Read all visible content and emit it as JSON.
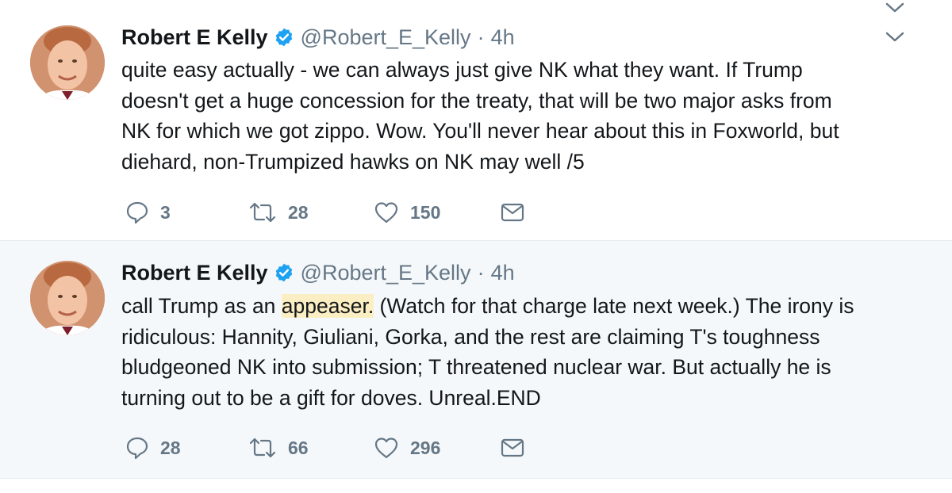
{
  "tweets": [
    {
      "author": {
        "name": "Robert E Kelly",
        "handle": "@Robert_E_Kelly",
        "verified": true,
        "avatar_icon": "avatar-photo"
      },
      "separator": "·",
      "time": "4h",
      "text_lines": [
        "quite easy actually - we can always just give NK what they want. If Trump",
        "doesn't get a huge concession for the treaty, that will be two major asks from",
        "NK for which we got zippo. Wow. You'll never hear about this in Foxworld, but",
        "diehard, non-Trumpized hawks on NK may well  /5"
      ],
      "actions": {
        "replies": "3",
        "retweets": "28",
        "likes": "150"
      }
    },
    {
      "author": {
        "name": "Robert E Kelly",
        "handle": "@Robert_E_Kelly",
        "verified": true,
        "avatar_icon": "avatar-photo"
      },
      "separator": "·",
      "time": "4h",
      "text_line1_before": "call Trump as an ",
      "text_highlight": "appeaser.",
      "text_line1_after": " (Watch for that charge late next week.) The irony is",
      "text_lines": [
        "ridiculous: Hannity, Giuliani, Gorka, and the rest are claiming T's toughness",
        "bludgeoned NK into submission; T threatened nuclear war. But actually he is",
        "turning out to be a gift for doves. Unreal.END"
      ],
      "actions": {
        "replies": "28",
        "retweets": "66",
        "likes": "296"
      }
    }
  ],
  "icons": [
    "verified-badge-icon",
    "caret-down-icon",
    "reply-icon",
    "retweet-icon",
    "like-icon",
    "dm-envelope-icon"
  ],
  "colors": {
    "verified": "#1da1f2",
    "secondary_text": "#657786",
    "thread_line": "#9ac7e4",
    "highlight": "#fbeec2",
    "focused_bg": "#f5f8fa"
  }
}
